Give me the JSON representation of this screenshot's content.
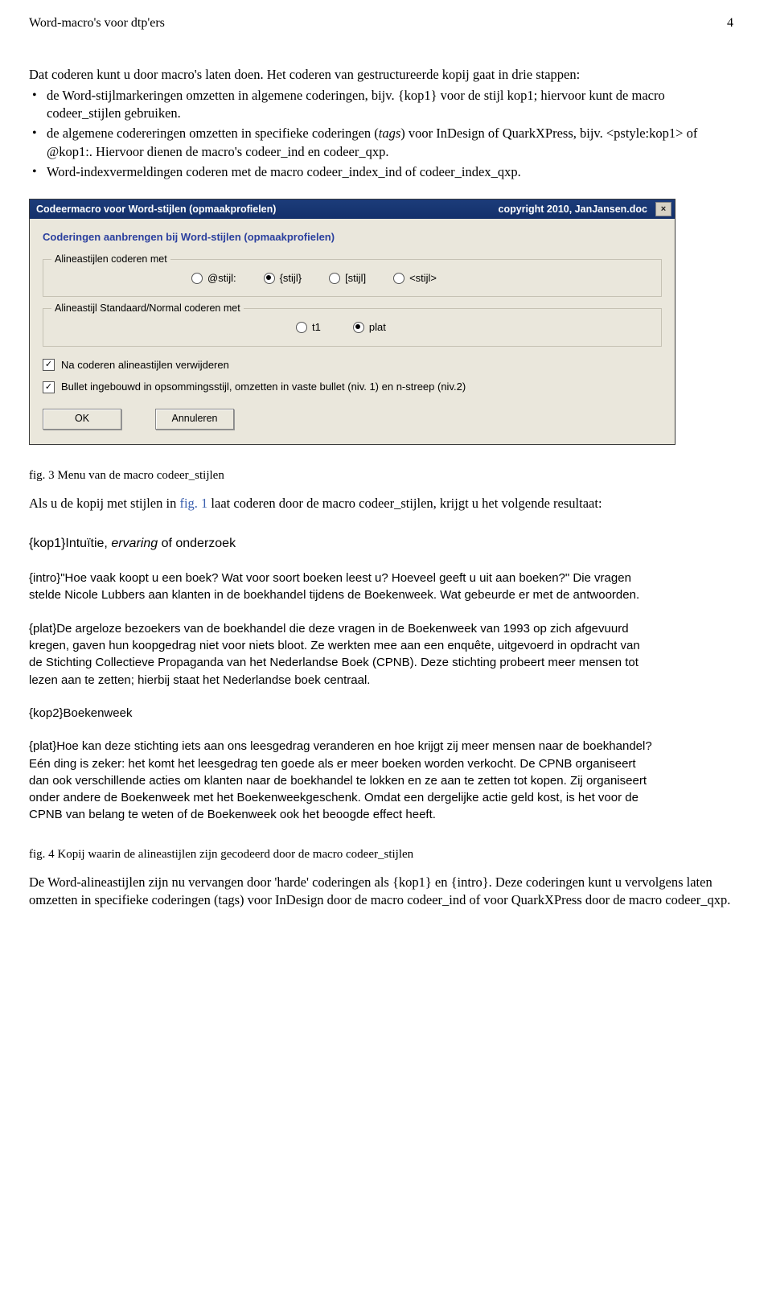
{
  "header": {
    "title": "Word-macro's voor dtp'ers",
    "page": "4"
  },
  "intro": "Dat coderen kunt u door macro's laten doen. Het coderen van gestructureerde kopij gaat in drie stappen:",
  "bullets": [
    "de Word-stijlmarkeringen omzetten in algemene coderingen, bijv. {kop1} voor de stijl kop1; hiervoor kunt de macro codeer_stijlen gebruiken.",
    "de algemene codereringen omzetten in specifieke coderingen (tags) voor InDesign of QuarkXPress, bijv. <pstyle:kop1> of @kop1:. Hiervoor dienen de macro's codeer_ind en codeer_qxp.",
    "Word-indexvermeldingen coderen met de macro codeer_index_ind of codeer_index_qxp."
  ],
  "dialog": {
    "title_left": "Codeermacro voor Word-stijlen (opmaakprofielen)",
    "title_right": "copyright 2010, JanJansen.doc",
    "heading": "Coderingen aanbrengen bij Word-stijlen (opmaakprofielen)",
    "group1_legend": "Alineastijlen coderen met",
    "group1_options": [
      "@stijl:",
      "{stijl}",
      "[stijl]",
      "<stijl>"
    ],
    "group1_selected": 1,
    "group2_legend": "Alineastijl Standaard/Normal coderen met",
    "group2_options": [
      "t1",
      "plat"
    ],
    "group2_selected": 1,
    "check1": "Na coderen alineastijlen verwijderen",
    "check2": "Bullet ingebouwd in opsommingsstijl, omzetten in vaste bullet (niv. 1) en n-streep (niv.2)",
    "ok": "OK",
    "cancel": "Annuleren"
  },
  "fig3": "fig. 3 Menu van de macro codeer_stijlen",
  "after_fig3_a": "Als u de kopij met stijlen in ",
  "after_fig3_link": "fig. 1",
  "after_fig3_b": " laat coderen door de macro codeer_stijlen, krijgt u het volgende resultaat:",
  "sample": {
    "p1a": "{kop1}Intuïtie, ",
    "p1i": "ervaring",
    "p1b": " of onderzoek",
    "p2": "{intro}\"Hoe vaak koopt u een boek? Wat voor soort boeken leest u? Hoeveel geeft u uit aan boeken?\" Die vragen stelde Nicole Lubbers aan klanten in de boekhandel tijdens de Boekenweek. Wat gebeurde er met de antwoorden.",
    "p3": "{plat}De argeloze bezoekers van de boekhandel die deze vragen in de Boekenweek van 1993 op zich afgevuurd kregen, gaven hun koopgedrag niet voor niets bloot. Ze werkten mee aan een enquête, uitgevoerd in opdracht van de Stichting Collectieve Propaganda van het Nederlandse Boek (CPNB). Deze stichting probeert meer mensen tot lezen aan te zetten; hierbij staat het Nederlandse boek centraal.",
    "p4": "{kop2}Boekenweek",
    "p5": "{plat}Hoe kan deze stichting iets aan ons leesgedrag veranderen en hoe krijgt zij meer mensen naar de boekhandel? Eén ding is zeker: het komt het leesgedrag ten goede als er meer boeken worden verkocht. De CPNB organiseert dan ook verschillende acties om klanten naar de boekhandel te lokken en ze aan te zetten tot kopen. Zij organiseert onder andere de Boekenweek met het Boekenweekgeschenk. Omdat een dergelijke actie geld kost, is het voor de CPNB van belang te weten of de Boekenweek ook het beoogde effect heeft."
  },
  "fig4": "fig. 4 Kopij waarin de alineastijlen zijn gecodeerd door de macro codeer_stijlen",
  "closing": "De Word-alineastijlen zijn nu vervangen door 'harde' coderingen als {kop1} en {intro}. Deze coderingen kunt u vervolgens laten omzetten in specifieke coderingen (tags) voor InDesign door de macro codeer_ind of voor QuarkXPress door de macro codeer_qxp."
}
